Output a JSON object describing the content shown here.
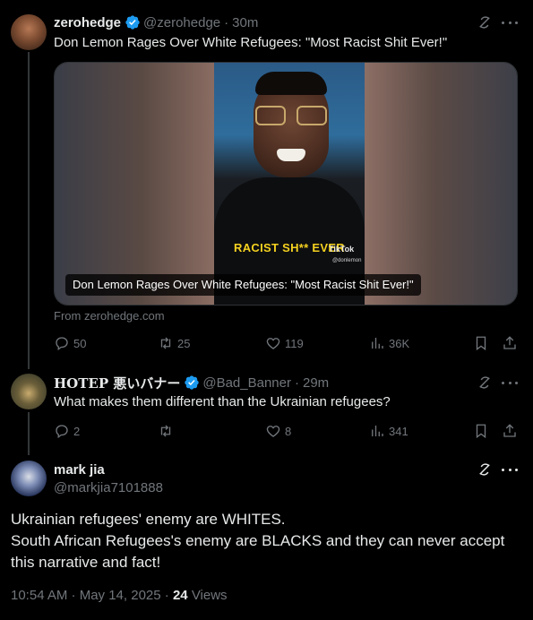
{
  "posts": [
    {
      "name": "zerohedge",
      "handle": "@zerohedge",
      "time": "30m",
      "text": "Don Lemon Rages Over White Refugees: \"Most Racist Shit Ever!\"",
      "card": {
        "overlay_text": "RACIST SH** EVER",
        "watermark": "TikTok",
        "watermark_handle": "@donlemon",
        "caption": "Don Lemon Rages Over White Refugees: \"Most Racist Shit Ever!\"",
        "source": "From zerohedge.com"
      },
      "stats": {
        "replies": "50",
        "reposts": "25",
        "likes": "119",
        "views": "36K"
      }
    },
    {
      "name": "HOTEP 悪いバナー",
      "handle": "@Bad_Banner",
      "time": "29m",
      "text": "What makes them different than the Ukrainian refugees?",
      "stats": {
        "replies": "2",
        "reposts": "",
        "likes": "8",
        "views": "341"
      }
    },
    {
      "name": "mark jia",
      "handle": "@markjia7101888",
      "text_lines": [
        "Ukrainian refugees' enemy are WHITES.",
        "South African Refugees's enemy are BLACKS and they can never accept",
        "this narrative and fact!"
      ],
      "timestamp": "10:54 AM · May 14, 2025",
      "views_count": "24",
      "views_label": "Views"
    }
  ],
  "separator": "·",
  "colors": {
    "accent": "#1d9bf0",
    "muted": "#71767b",
    "text": "#e7e9ea",
    "background": "#000000"
  }
}
